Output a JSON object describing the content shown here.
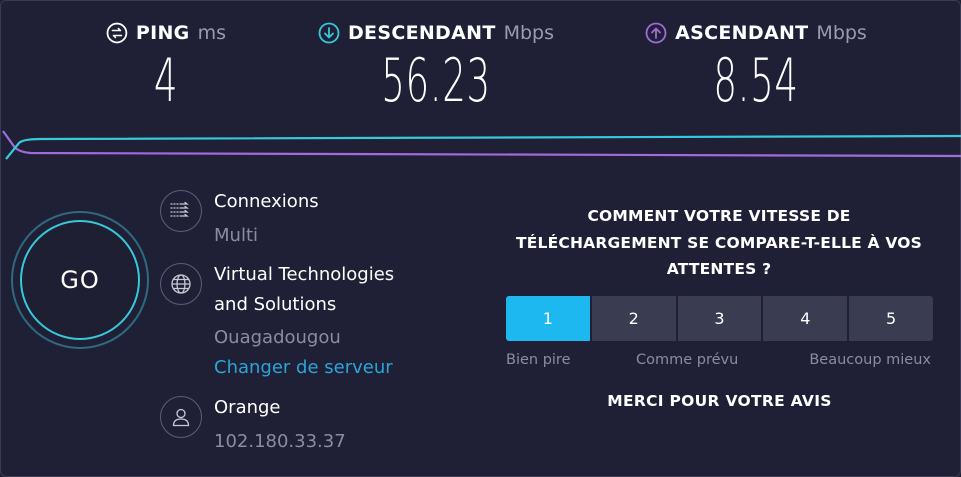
{
  "results": {
    "ping": {
      "name": "PING",
      "unit": "ms",
      "value": "4",
      "icon": "ping-icon"
    },
    "download": {
      "name": "DESCENDANT",
      "unit": "Mbps",
      "value": "56.23",
      "icon": "download-icon",
      "color": "#37c8dc"
    },
    "upload": {
      "name": "ASCENDANT",
      "unit": "Mbps",
      "value": "8.54",
      "icon": "upload-icon",
      "color": "#a06bdc"
    }
  },
  "go_button": {
    "label": "GO"
  },
  "connections": {
    "label": "Connexions",
    "value": "Multi",
    "icon": "connections-icon"
  },
  "server": {
    "name_line1": "Virtual Technologies",
    "name_line2": "and Solutions",
    "location": "Ouagadougou",
    "change_link": "Changer de serveur",
    "icon": "globe-icon"
  },
  "provider": {
    "name": "Orange",
    "ip": "102.180.33.37",
    "icon": "user-icon"
  },
  "survey": {
    "question_line1": "COMMENT VOTRE VITESSE DE",
    "question_line2": "TÉLÉCHARGEMENT SE COMPARE-T-ELLE À VOS",
    "question_line3": "ATTENTES ?",
    "options": [
      "1",
      "2",
      "3",
      "4",
      "5"
    ],
    "selected": "1",
    "label_low": "Bien pire",
    "label_mid": "Comme prévu",
    "label_high": "Beaucoup mieux",
    "thanks": "MERCI POUR VOTRE AVIS"
  },
  "colors": {
    "accent": "#1cb8ef",
    "link": "#2ba4dc",
    "background": "#1f2035"
  }
}
